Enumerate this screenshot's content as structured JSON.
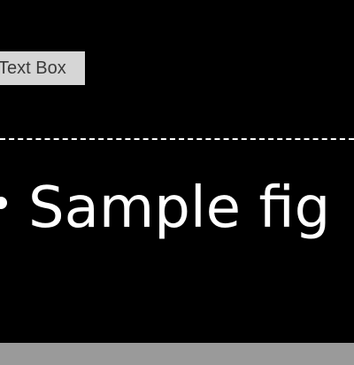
{
  "element_tag": {
    "label": "Text Box"
  },
  "content": {
    "heading": "Sample fig"
  },
  "colors": {
    "background": "#000000",
    "tag_background": "#d6d6d6",
    "text": "#ffffff",
    "footer": "#9a9a9a"
  }
}
